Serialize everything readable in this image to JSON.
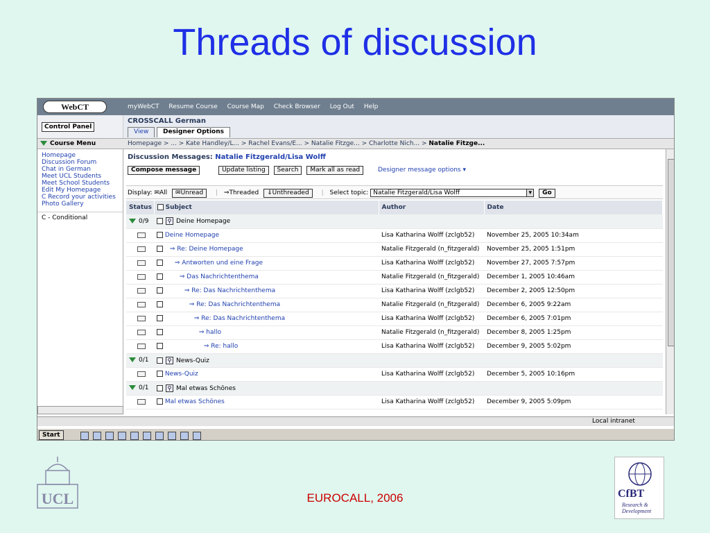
{
  "slide": {
    "title": "Threads of discussion",
    "footer": "EUROCALL, 2006",
    "left_logo": "UCL",
    "right_logo": "CfBT",
    "right_logo_sub": "Research & Development"
  },
  "webct": {
    "logo": "WebCT",
    "topnav": [
      "myWebCT",
      "Resume Course",
      "Course Map",
      "Check Browser",
      "Log Out",
      "Help"
    ],
    "control_panel": "Control Panel",
    "course_name": "CROSSCALL German",
    "tabs": [
      "View",
      "Designer Options"
    ],
    "course_menu_label": "Course Menu",
    "breadcrumb": "Homepage > ... > Kate Handley/L... > Rachel Evans/E... > Natalie Fitzge... > Charlotte Nich... >",
    "breadcrumb_current": "Natalie Fitzge...",
    "menu": [
      "Homepage",
      "Discussion Forum",
      "Chat in German",
      "Meet UCL Students",
      "Meet School Students",
      "Edit My Homepage",
      "C Record your activities",
      "Photo Gallery"
    ],
    "menu_conditional": "C - Conditional",
    "dm_label": "Discussion Messages:",
    "dm_topic": "Natalie Fitzgerald/Lisa Wolff",
    "buttons": {
      "compose": "Compose message",
      "update": "Update listing",
      "search": "Search",
      "markall": "Mark all as read",
      "designer": "Designer message options ▾"
    },
    "display": {
      "label": "Display:",
      "all": "All",
      "unread": "Unread",
      "threaded": "Threaded",
      "unthreaded": "Unthreaded",
      "select_topic_label": "Select topic:",
      "select_topic_value": "Natalie Fitzgerald/Lisa Wolff",
      "go": "Go"
    },
    "columns": {
      "status": "Status",
      "subject": "Subject",
      "author": "Author",
      "date": "Date"
    },
    "rows": [
      {
        "kind": "topic",
        "status": "0/9",
        "subject": "Deine Homepage",
        "author": "",
        "date": ""
      },
      {
        "kind": "msg",
        "depth": 0,
        "subject": "Deine Homepage",
        "author": "Lisa Katharina Wolff (zclgb52)",
        "date": "November 25, 2005 10:34am"
      },
      {
        "kind": "msg",
        "depth": 1,
        "subject": "Re: Deine Homepage",
        "author": "Natalie Fitzgerald (n_fitzgerald)",
        "date": "November 25, 2005 1:51pm"
      },
      {
        "kind": "msg",
        "depth": 2,
        "subject": "Antworten und eine Frage",
        "author": "Lisa Katharina Wolff (zclgb52)",
        "date": "November 27, 2005 7:57pm"
      },
      {
        "kind": "msg",
        "depth": 3,
        "subject": "Das Nachrichtenthema",
        "author": "Natalie Fitzgerald (n_fitzgerald)",
        "date": "December 1, 2005 10:46am"
      },
      {
        "kind": "msg",
        "depth": 4,
        "subject": "Re: Das Nachrichtenthema",
        "author": "Lisa Katharina Wolff (zclgb52)",
        "date": "December 2, 2005 12:50pm"
      },
      {
        "kind": "msg",
        "depth": 5,
        "subject": "Re: Das Nachrichtenthema",
        "author": "Natalie Fitzgerald (n_fitzgerald)",
        "date": "December 6, 2005 9:22am"
      },
      {
        "kind": "msg",
        "depth": 6,
        "subject": "Re: Das Nachrichtenthema",
        "author": "Lisa Katharina Wolff (zclgb52)",
        "date": "December 6, 2005 7:01pm"
      },
      {
        "kind": "msg",
        "depth": 7,
        "subject": "hallo",
        "author": "Natalie Fitzgerald (n_fitzgerald)",
        "date": "December 8, 2005 1:25pm"
      },
      {
        "kind": "msg",
        "depth": 8,
        "subject": "Re: hallo",
        "author": "Lisa Katharina Wolff (zclgb52)",
        "date": "December 9, 2005 5:02pm"
      },
      {
        "kind": "topic",
        "status": "0/1",
        "subject": "News-Quiz",
        "author": "",
        "date": ""
      },
      {
        "kind": "msg",
        "depth": 0,
        "subject": "News-Quiz",
        "author": "Lisa Katharina Wolff (zclgb52)",
        "date": "December 5, 2005 10:16pm"
      },
      {
        "kind": "topic",
        "status": "0/1",
        "subject": "Mal etwas Schönes",
        "author": "",
        "date": ""
      },
      {
        "kind": "msg",
        "depth": 0,
        "subject": "Mal etwas Schönes",
        "author": "Lisa Katharina Wolff (zclgb52)",
        "date": "December 9, 2005 5:09pm"
      }
    ],
    "status_bar": "Local intranet",
    "taskbar_start": "Start"
  }
}
